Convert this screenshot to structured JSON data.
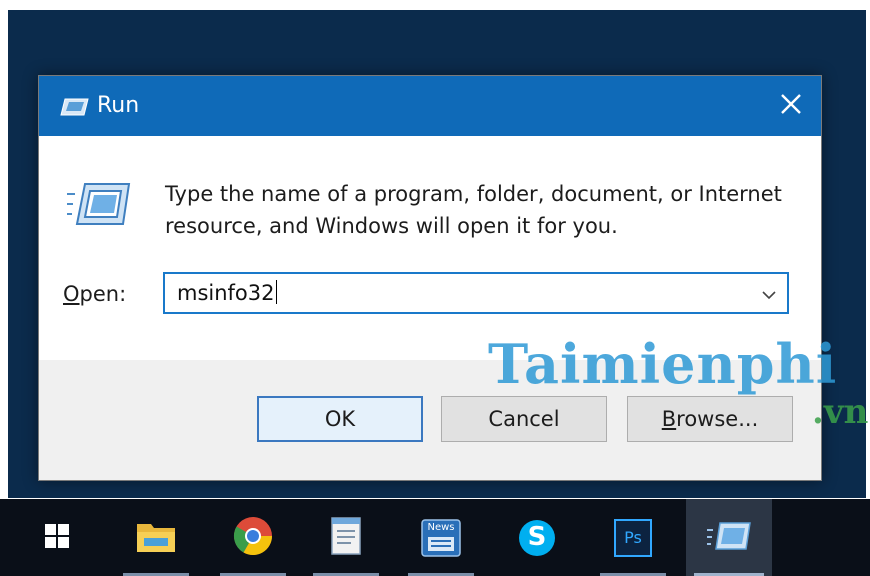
{
  "dialog": {
    "title": "Run",
    "close_icon": "close-icon",
    "prompt_line1": "Type the name of a program, folder, document, or Internet",
    "prompt_line2": "resource, and Windows will open it for you.",
    "open_label_accel": "O",
    "open_label_rest": "pen:",
    "open_value": "msinfo32",
    "buttons": {
      "ok": "OK",
      "cancel": "Cancel",
      "browse_accel": "B",
      "browse_rest": "rowse..."
    }
  },
  "watermark": {
    "main": "Taimienphi",
    "sub": ".vn"
  },
  "taskbar": {
    "items": [
      "windows-start-icon",
      "file-explorer-icon",
      "chrome-icon",
      "notepad-icon",
      "news-app-icon",
      "skype-icon",
      "photoshop-icon",
      "run-icon"
    ],
    "news_label": "News",
    "photoshop_label": "Ps",
    "skype_label": "S"
  },
  "colors": {
    "titlebar": "#0f6ab8",
    "accent": "#1979ca",
    "taskbar": "#0a0f18"
  }
}
